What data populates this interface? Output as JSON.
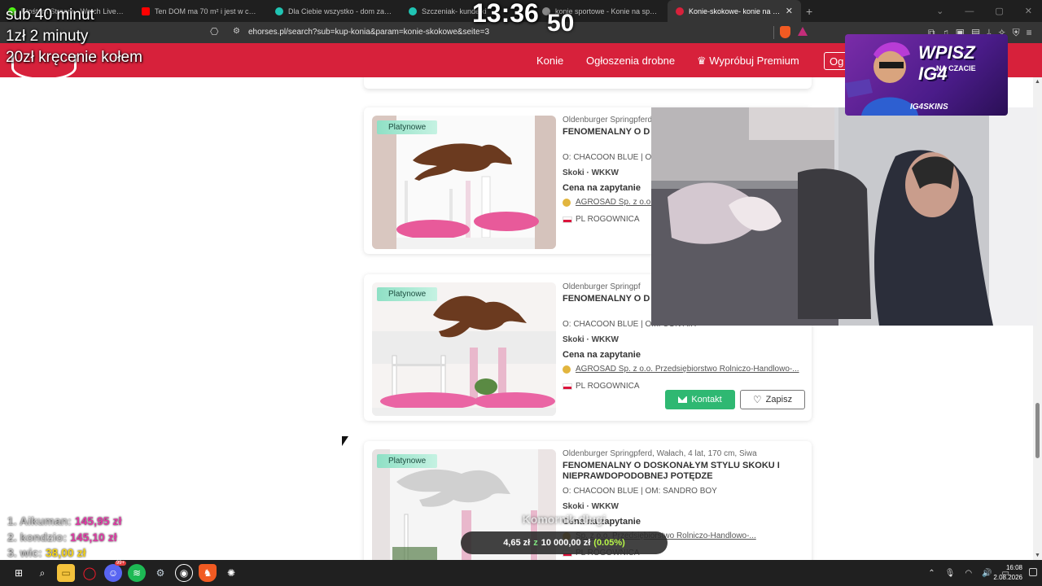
{
  "browser": {
    "tabs": [
      {
        "title": "Ktośtam Stream - Watch Live on Kick",
        "color": "#53fc18",
        "active": false
      },
      {
        "title": "Ten DOM ma 70 m² i jest w cenie U2",
        "color": "#ff0000",
        "active": false
      },
      {
        "title": "Dla Ciebie wszystko - dom za darmo",
        "color": "#20c4b3",
        "active": false
      },
      {
        "title": "Szczeniak- kundelki",
        "color": "#20c4b3",
        "active": false
      },
      {
        "title": "konie sportowe - Konie na sprzedaż",
        "color": "#888888",
        "active": false
      },
      {
        "title": "Konie-skokowe- konie na sprzedaż",
        "color": "#d7213b",
        "active": true
      }
    ],
    "url": "ehorses.pl/search?sub=kup-konia&param=konie-skokowe&seite=3"
  },
  "site": {
    "nav": {
      "konie": "Konie",
      "ogloszenia": "Ogłoszenia drobne",
      "premium": "Wypróbuj Premium",
      "ogl_button": "Og"
    },
    "accent": "#d7213b"
  },
  "listings": [
    {
      "badge": "Platynowe",
      "spec": "Oldenburger Springpferd",
      "title": "FENOMENALNY O D NIEPRAWDOPODOB",
      "pedigree": "O: CHACOON BLUE | OM",
      "discipline": "Skoki · WKKW",
      "price": "Cena na zapytanie",
      "seller": "AGROSAD Sp. z o.o.",
      "location": "PL ROGOWNICA",
      "horse_color": "#6b3a1f"
    },
    {
      "badge": "Platynowe",
      "spec": "Oldenburger Springpf",
      "title": "FENOMENALNY O D NIEPRAWDOPODOB",
      "pedigree": "O: CHACOON BLUE | OM: CON AIR",
      "discipline": "Skoki · WKKW",
      "price": "Cena na zapytanie",
      "seller": "AGROSAD Sp. z o.o. Przedsiębiorstwo Rolniczo-Handlowo-...",
      "location": "PL ROGOWNICA",
      "contact_label": "Kontakt",
      "save_label": "Zapisz",
      "horse_color": "#6b3a1f"
    },
    {
      "badge": "Platynowe",
      "spec": "Oldenburger Springpferd, Wałach, 4 lat, 170 cm, Siwa",
      "title": "FENOMENALNY O DOSKONAŁYM STYLU SKOKU I NIEPRAWDOPODOBNEJ POTĘDZE",
      "pedigree": "O: CHACOON BLUE | OM: SANDRO BOY",
      "discipline": "Skoki · WKKW",
      "price": "Cena na zapytanie",
      "seller": "Sp. z o.o. Przedsiębiorstwo Rolniczo-Handlowo-...",
      "location": "PL ROGOWNICA",
      "horse_color": "#d0d0d0"
    }
  ],
  "overlay": {
    "sub_line": "sub 40 minut",
    "zl_line": "1zł 2 minuty",
    "kr_line": "20zł kręcenie kołem",
    "clock_top": "13:36",
    "clock_bottom": "50",
    "ad_title": "WPISZ IG4",
    "ad_sub": "NA CZACIE",
    "ad_brand": "IG4SKINS",
    "leaderboard": [
      {
        "name": "1. Aikuman:",
        "amount": "145,95 zł"
      },
      {
        "name": "2. kondzio:",
        "amount": "145,10 zł"
      },
      {
        "name": "3. wic:",
        "amount": "38,00 zł"
      }
    ],
    "goal_title": "Komornik długi",
    "goal_current": "4,65 zł",
    "goal_sep": "z",
    "goal_target": "10 000,00 zł",
    "goal_pct": "(0.05%)",
    "goal_progress": 0.0005
  },
  "taskbar": {
    "time": "16:08",
    "date": "2.08.2026",
    "discord_badge": "99+"
  }
}
